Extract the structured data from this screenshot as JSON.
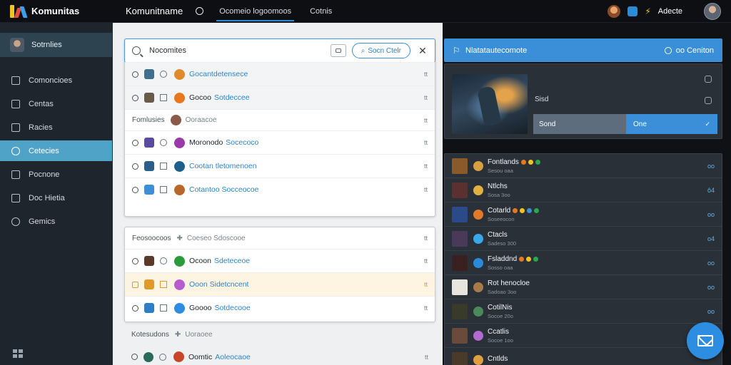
{
  "brand": {
    "name": "Komunitas"
  },
  "topbar": {
    "username": "Komunitname",
    "tabs": [
      {
        "label": "Ocomeio logoomoos",
        "active": true
      },
      {
        "label": "Cotnis",
        "active": false
      }
    ],
    "right_label": "Adecte"
  },
  "sidebar": {
    "profile_label": "Sotrnlies",
    "items": [
      {
        "label": "Comoncioes"
      },
      {
        "label": "Centas"
      },
      {
        "label": "Racies"
      },
      {
        "label": "Cetecies",
        "active": true
      },
      {
        "label": "Pocnone"
      },
      {
        "label": "Doc Hietia"
      },
      {
        "label": "Gemics"
      }
    ]
  },
  "search": {
    "value": "Nocomites",
    "pill_label": "Socn Ctelr",
    "close_glyph": "✕"
  },
  "results": [
    {
      "strong": "",
      "link": "Gocantdetensece",
      "more": "tt",
      "shade": true,
      "thumb": "#3d6f8f",
      "dot": "#e08a2a",
      "box": "circle"
    },
    {
      "strong": "Gocoo",
      "link": "Sotdeccee",
      "more": "tt",
      "shade": true,
      "thumb": "#6a5a4a",
      "dot": "#e8771e",
      "box": "square"
    }
  ],
  "section1": {
    "label": "Fomlusies",
    "muted": "Ooraacoe",
    "more": "tt"
  },
  "results2": [
    {
      "strong": "Moronodo",
      "link": "Socecoco",
      "more": "tt",
      "thumb": "#5a4aa0",
      "dot": "#9a3aa8",
      "box": "circle"
    },
    {
      "strong": "",
      "link": "Cootan tletomenoen",
      "more": "tt",
      "thumb": "#2a5f8c",
      "dot": "#1d5f8c",
      "box": "square"
    },
    {
      "strong": "",
      "link": "Cotantoo Socceocoe",
      "more": "tt",
      "thumb": "#3a8fd8",
      "dot": "#b8672a",
      "box": "square"
    }
  ],
  "section2": {
    "label": "Feosoocoos",
    "muted": "Coeseo Sdoscooe",
    "more": "tt"
  },
  "results3": [
    {
      "strong": "Ocoon",
      "link": "Sdeteceoe",
      "more": "tt",
      "amber": false,
      "thumb": "#5c3a2a",
      "dot": "#2a9a3c",
      "box": "circle"
    },
    {
      "strong": "",
      "link": "Ooon Sidetcncent",
      "more": "tt",
      "amber": true,
      "thumb": "#e09a2a",
      "dot": "#b85ad0",
      "box": "square"
    },
    {
      "strong": "Goooo",
      "link": "Sotdecooe",
      "more": "tt",
      "amber": false,
      "thumb": "#2a7fc8",
      "dot": "#2d8de0",
      "box": "square"
    }
  ],
  "section3": {
    "label": "Kotesudons",
    "muted": "Uoraoee"
  },
  "results4": [
    {
      "strong": "Oomtic",
      "link": "Aoleocaoe",
      "more": "tt",
      "thumb": "#2a6a5a",
      "dot": "#c8452a",
      "box": "circle"
    }
  ],
  "banner": {
    "title": "Nlatatautecomote",
    "action": "oo Ceniton"
  },
  "media": {
    "text": "Sisd",
    "select_left": "Sond",
    "select_right": "One"
  },
  "feed": [
    {
      "name": "Fontlands",
      "sub": "Sesou oaa",
      "count": "oo",
      "thumb": "#8a5a2a",
      "avatar": "#d8a040",
      "emoji": [
        "#e8771e",
        "#f3c321",
        "#2aa84a"
      ]
    },
    {
      "name": "Ntlchs",
      "sub": "Sosa 3oo",
      "count": "ô4",
      "thumb": "#5a3030",
      "avatar": "#e0b040",
      "emoji": []
    },
    {
      "name": "Cotarld",
      "sub": "Soseeocon",
      "count": "oo",
      "thumb": "#2a4a8a",
      "avatar": "#e07a2a",
      "emoji": [
        "#e8771e",
        "#f3c321",
        "#3a8fd8",
        "#2aa84a"
      ]
    },
    {
      "name": "Ctacls",
      "sub": "Sadeso 300",
      "count": "o4",
      "thumb": "#4a3a5a",
      "avatar": "#3aa8e8",
      "emoji": []
    },
    {
      "name": "Fsladdnd",
      "sub": "Sosso oaa",
      "count": "oo",
      "thumb": "#3a2020",
      "avatar": "#2a8ad8",
      "emoji": [
        "#e8771e",
        "#f3c321",
        "#2aa84a"
      ]
    },
    {
      "name": "Rot henocloe",
      "sub": "Sadoao 3oo",
      "count": "oo",
      "thumb": "#e8e4de",
      "avatar": "#a87a4a",
      "emoji": []
    },
    {
      "name": "CotilNis",
      "sub": "Socoe 20o",
      "count": "oo",
      "thumb": "#3a3a2a",
      "avatar": "#4a8a5a",
      "emoji": []
    },
    {
      "name": "Ccatlis",
      "sub": "Socoe 1oo",
      "count": "oo",
      "thumb": "#6a4a3a",
      "avatar": "#b06ad0",
      "emoji": []
    },
    {
      "name": "Cntlds",
      "sub": "",
      "count": "",
      "thumb": "#4a3a2a",
      "avatar": "#e0a040",
      "emoji": []
    }
  ]
}
